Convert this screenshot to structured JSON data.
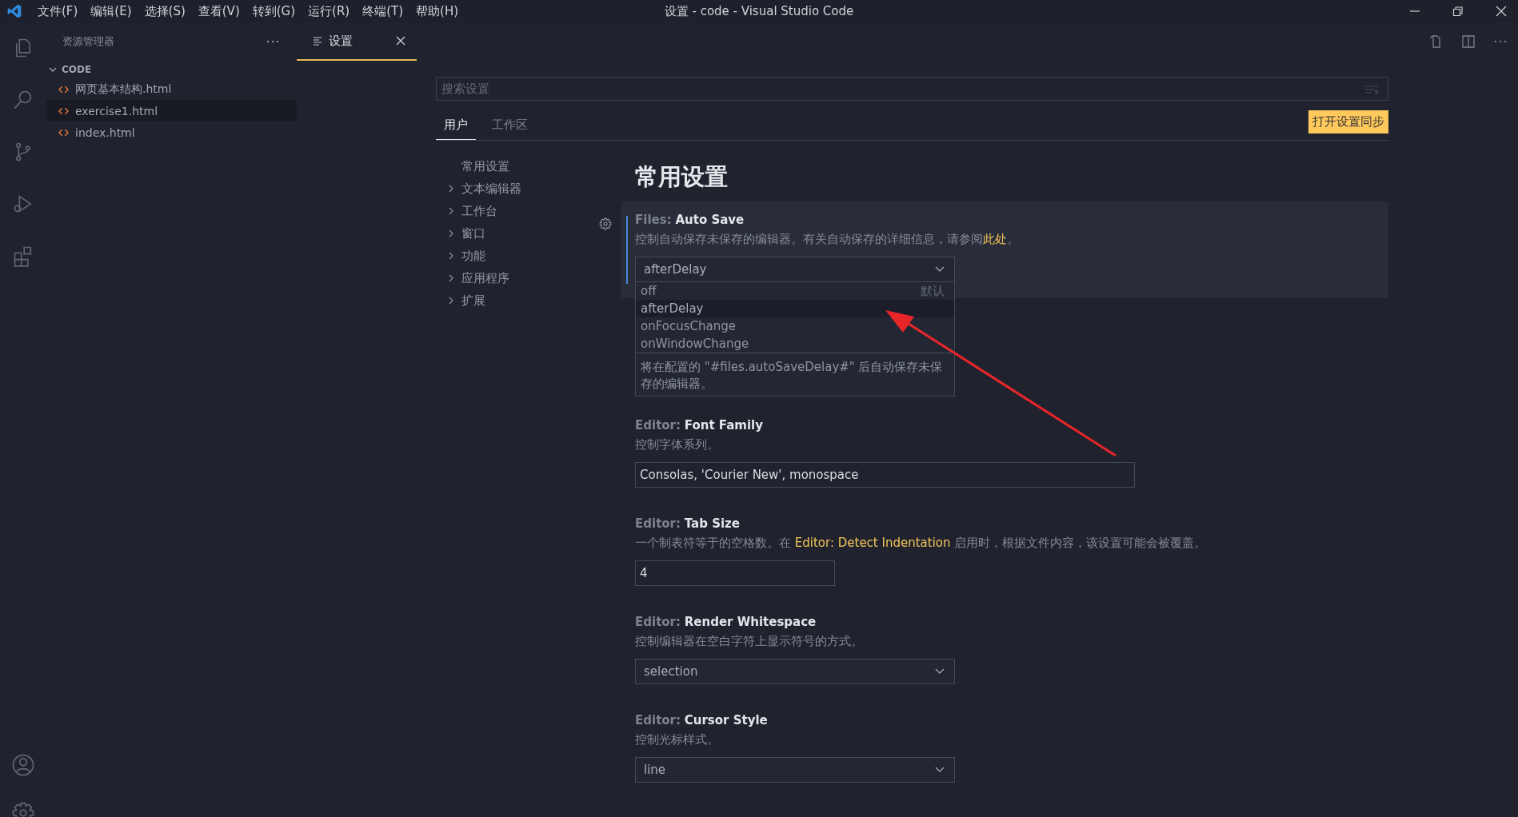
{
  "menu": [
    "文件(F)",
    "编辑(E)",
    "选择(S)",
    "查看(V)",
    "转到(G)",
    "运行(R)",
    "终端(T)",
    "帮助(H)"
  ],
  "window_title": "设置 - code - Visual Studio Code",
  "explorer": {
    "title": "资源管理器",
    "folder": {
      "name": "CODE",
      "expanded": true
    },
    "files": [
      {
        "name": "网页基本结构.html",
        "selected": false
      },
      {
        "name": "exercise1.html",
        "selected": true
      },
      {
        "name": "index.html",
        "selected": false
      }
    ]
  },
  "editor_tab": {
    "label": "设置"
  },
  "settings": {
    "search": {
      "placeholder": "搜索设置"
    },
    "scope_tabs": [
      {
        "label": "用户",
        "selected": true
      },
      {
        "label": "工作区",
        "selected": false
      }
    ],
    "sync_button": "打开设置同步",
    "toc": [
      {
        "label": "常用设置",
        "expandable": false
      },
      {
        "label": "文本编辑器",
        "expandable": true
      },
      {
        "label": "工作台",
        "expandable": true
      },
      {
        "label": "窗口",
        "expandable": true
      },
      {
        "label": "功能",
        "expandable": true
      },
      {
        "label": "应用程序",
        "expandable": true
      },
      {
        "label": "扩展",
        "expandable": true
      }
    ],
    "heading": "常用设置",
    "items": [
      {
        "kind": "select",
        "category": "Files:",
        "name": "Auto Save",
        "focused": true,
        "description": [
          {
            "kind": "text",
            "text": "控制自动保存未保存的编辑器。有关自动保存的详细信息，请参阅"
          },
          {
            "kind": "link",
            "text": "此处"
          },
          {
            "kind": "text",
            "text": "。"
          }
        ],
        "value": "afterDelay",
        "open": true,
        "options": [
          {
            "label": "off",
            "selected": false,
            "note": "默认"
          },
          {
            "label": "afterDelay",
            "selected": true
          },
          {
            "label": "onFocusChange",
            "selected": false
          },
          {
            "label": "onWindowChange",
            "selected": false
          }
        ],
        "option_description": "将在配置的 \"#files.autoSaveDelay#\" 后自动保存未保存的编辑器。"
      },
      {
        "kind": "text",
        "category": "Editor:",
        "name": "Font Family",
        "focused": false,
        "description": [
          {
            "kind": "text",
            "text": "控制字体系列。"
          }
        ],
        "value": "Consolas, 'Courier New', monospace"
      },
      {
        "kind": "number",
        "category": "Editor:",
        "name": "Tab Size",
        "focused": false,
        "description": [
          {
            "kind": "text",
            "text": "一个制表符等于的空格数。在 "
          },
          {
            "kind": "link",
            "text": "Editor: Detect Indentation"
          },
          {
            "kind": "text",
            "text": " 启用时，根据文件内容，该设置可能会被覆盖。"
          }
        ],
        "value": "4"
      },
      {
        "kind": "select",
        "category": "Editor:",
        "name": "Render Whitespace",
        "focused": false,
        "description": [
          {
            "kind": "text",
            "text": "控制编辑器在空白字符上显示符号的方式。"
          }
        ],
        "value": "selection",
        "open": false
      },
      {
        "kind": "select",
        "category": "Editor:",
        "name": "Cursor Style",
        "focused": false,
        "description": [
          {
            "kind": "text",
            "text": "控制光标样式。"
          }
        ],
        "value": "line",
        "open": false
      }
    ]
  }
}
